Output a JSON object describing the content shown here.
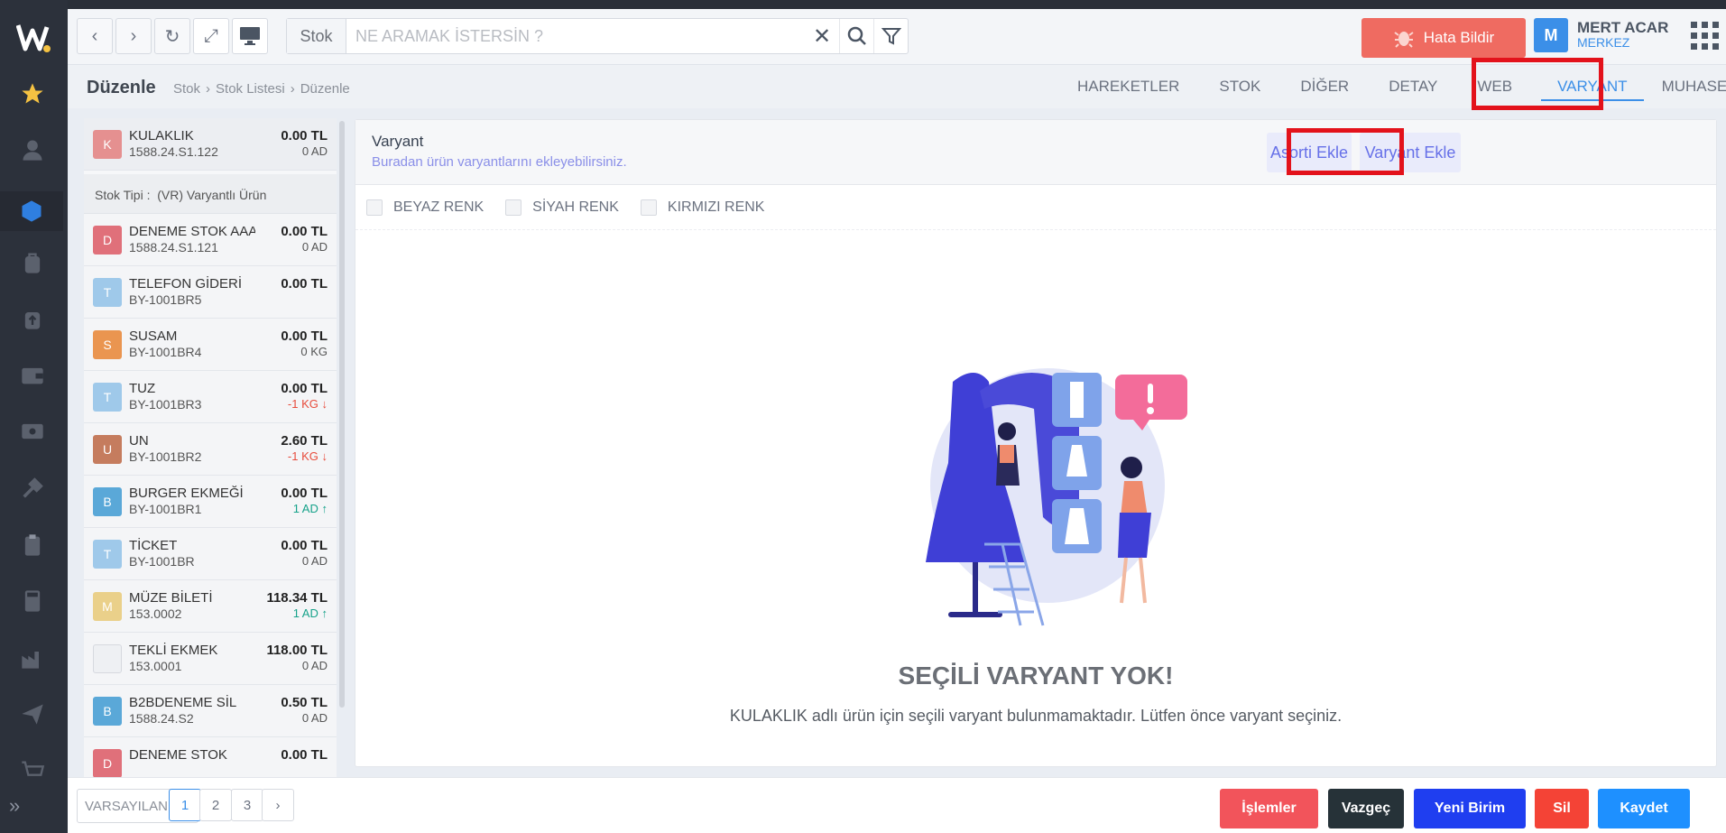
{
  "toolbar": {
    "search_scope": "Stok",
    "search_placeholder": "NE ARAMAK İSTERSİN ?",
    "report_bug": "Hata Bildir",
    "user_initial": "M",
    "user_name": "MERT ACAR",
    "user_branch": "MERKEZ"
  },
  "subbar": {
    "title": "Düzenle",
    "breadcrumb": [
      "Stok",
      "Stok Listesi",
      "Düzenle"
    ],
    "tabs": [
      "HAREKETLER",
      "STOK",
      "DİĞER",
      "DETAY",
      "WEB",
      "VARYANT",
      "MUHASEBE"
    ],
    "active_tab": "VARYANT"
  },
  "selected_item": {
    "badge": "K",
    "name": "KULAKLIK",
    "code": "1588.24.S1.122",
    "price": "0.00 TL",
    "qty": "0 AD",
    "type_label": "Stok Tipi :",
    "type_value": "(VR) Varyantlı Ürün"
  },
  "items": [
    {
      "badge": "D",
      "color": "#e0707a",
      "name": "DENEME STOK AAA",
      "code": "1588.24.S1.121",
      "price": "0.00 TL",
      "qty": "0 AD",
      "trend": ""
    },
    {
      "badge": "T",
      "color": "#9fc9ea",
      "name": "TELEFON GİDERİ",
      "code": "BY-1001BR5",
      "price": "0.00 TL",
      "qty": "",
      "trend": ""
    },
    {
      "badge": "S",
      "color": "#ea9550",
      "name": "SUSAM",
      "code": "BY-1001BR4",
      "price": "0.00 TL",
      "qty": "0 KG",
      "trend": ""
    },
    {
      "badge": "T",
      "color": "#9fc9ea",
      "name": "TUZ",
      "code": "BY-1001BR3",
      "price": "0.00 TL",
      "qty": "-1 KG",
      "trend": "down"
    },
    {
      "badge": "U",
      "color": "#c57c5e",
      "name": "UN",
      "code": "BY-1001BR2",
      "price": "2.60 TL",
      "qty": "-1 KG",
      "trend": "down"
    },
    {
      "badge": "B",
      "color": "#5aa8d8",
      "name": "BURGER EKMEĞİ",
      "code": "BY-1001BR1",
      "price": "0.00 TL",
      "qty": "1 AD",
      "trend": "up"
    },
    {
      "badge": "T",
      "color": "#9fc9ea",
      "name": "TİCKET",
      "code": "BY-1001BR",
      "price": "0.00 TL",
      "qty": "0 AD",
      "trend": ""
    },
    {
      "badge": "M",
      "color": "#ead08a",
      "name": "MÜZE BİLETİ",
      "code": "153.0002",
      "price": "118.34 TL",
      "qty": "1 AD",
      "trend": "up"
    },
    {
      "badge": "",
      "color": "#eef0f3",
      "name": "TEKLİ EKMEK",
      "code": "153.0001",
      "price": "118.00 TL",
      "qty": "0 AD",
      "trend": ""
    },
    {
      "badge": "B",
      "color": "#5aa8d8",
      "name": "B2BDENEME SİL",
      "code": "1588.24.S2",
      "price": "0.50 TL",
      "qty": "0 AD",
      "trend": ""
    },
    {
      "badge": "D",
      "color": "#e0707a",
      "name": "DENEME STOK",
      "code": "",
      "price": "0.00 TL",
      "qty": "",
      "trend": ""
    }
  ],
  "content": {
    "title": "Varyant",
    "subtitle": "Buradan ürün varyantlarını ekleyebilirsiniz.",
    "btn_asorti": "Asorti Ekle",
    "btn_varyant": "Varyant Ekle",
    "checkboxes": [
      "BEYAZ RENK",
      "SİYAH RENK",
      "KIRMIZI RENK"
    ],
    "empty_title": "SEÇİLİ VARYANT YOK!",
    "empty_message": "KULAKLIK adlı ürün için seçili varyant bulunmamaktadır. Lütfen önce varyant seçiniz."
  },
  "bottom": {
    "default_select": "VARSAYILAN",
    "pages": [
      "1",
      "2",
      "3"
    ],
    "current_page": "1",
    "actions": [
      {
        "label": "İşlemler",
        "color": "#f2545b"
      },
      {
        "label": "Vazgeç",
        "color": "#263238"
      },
      {
        "label": "Yeni Birim",
        "color": "#1f3ef0"
      },
      {
        "label": "Sil",
        "color": "#f44336"
      },
      {
        "label": "Kaydet",
        "color": "#1e90ff"
      }
    ]
  }
}
